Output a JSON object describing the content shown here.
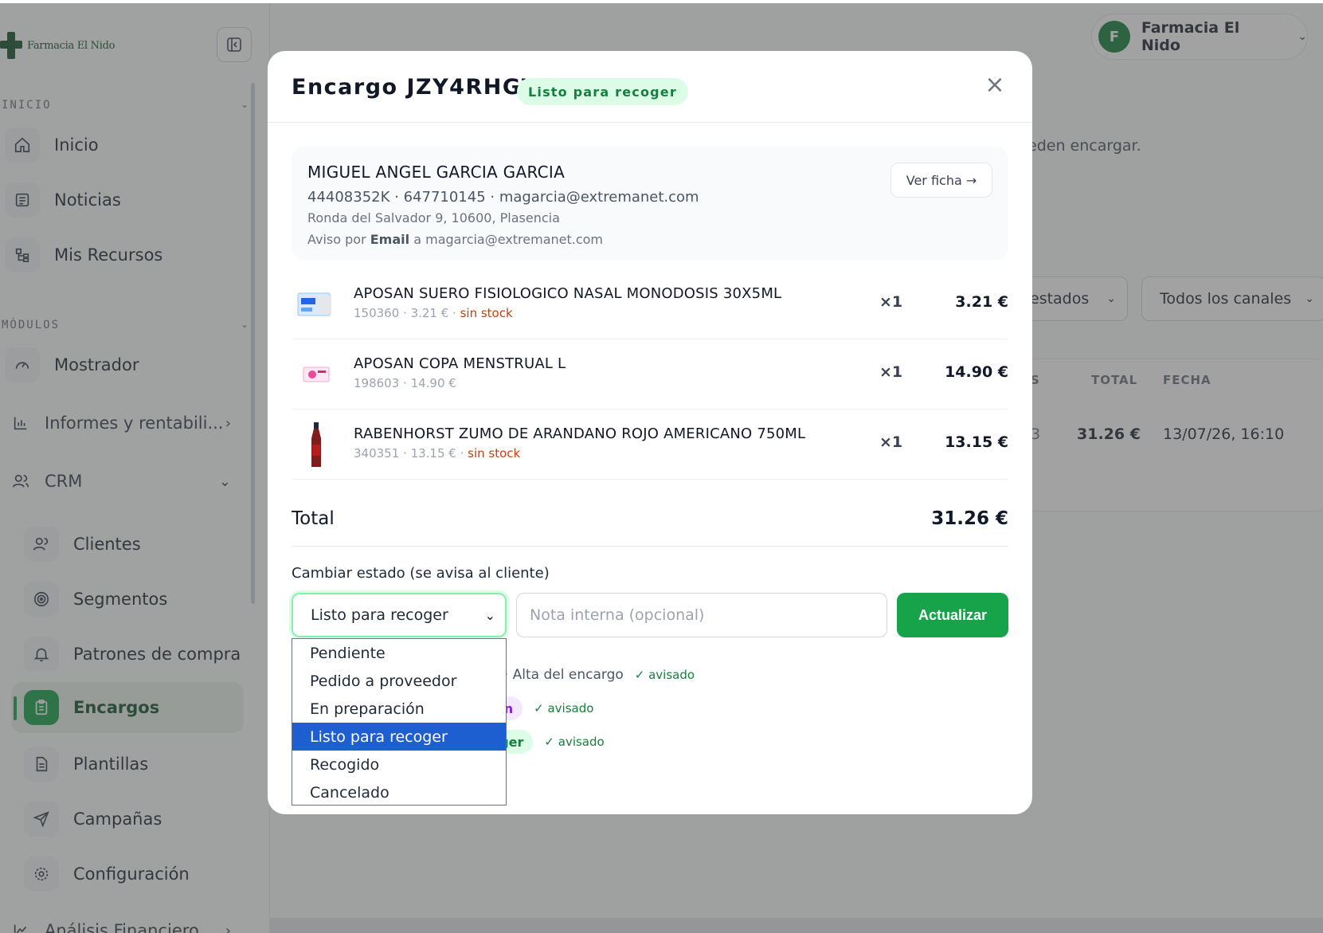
{
  "app": {
    "brand_name": "Farmacia El Nido",
    "user_initial": "F",
    "user_name": "Farmacia El Nido"
  },
  "sidebar": {
    "section_inicio": "INICIO",
    "section_modulos": "MÓDULOS",
    "items": [
      {
        "label": "Inicio",
        "icon": "home-icon"
      },
      {
        "label": "Noticias",
        "icon": "newspaper-icon"
      },
      {
        "label": "Mis Recursos",
        "icon": "resources-icon"
      },
      {
        "label": "Mostrador",
        "icon": "gauge-icon"
      },
      {
        "label": "Informes y rentabili...",
        "icon": "bar-chart-icon"
      },
      {
        "label": "CRM",
        "icon": "users-icon"
      },
      {
        "label": "Clientes",
        "icon": "users-icon"
      },
      {
        "label": "Segmentos",
        "icon": "target-icon"
      },
      {
        "label": "Patrones de compra",
        "icon": "bell-icon"
      },
      {
        "label": "Encargos",
        "icon": "clipboard-icon",
        "active": true
      },
      {
        "label": "Plantillas",
        "icon": "file-icon"
      },
      {
        "label": "Campañas",
        "icon": "send-icon"
      },
      {
        "label": "Configuración",
        "icon": "gear-icon"
      },
      {
        "label": "Análisis Financiero",
        "icon": "line-chart-icon"
      }
    ]
  },
  "background": {
    "partial_text": "eden encargar.",
    "filter_states": "estados",
    "filter_channels": "Todos los canales",
    "table_headers": [
      "S",
      "TOTAL",
      "FECHA"
    ],
    "row": {
      "partial": "3",
      "total": "31.26 €",
      "date": "13/07/26, 16:10"
    }
  },
  "modal": {
    "title": "Encargo JZY4RHGV",
    "status": "Listo para recoger",
    "close": "×",
    "customer": {
      "name": "MIGUEL ANGEL GARCIA GARCIA",
      "ids": "44408352K · 647710145 · magarcia@extremanet.com",
      "address": "Ronda del Salvador 9, 10600, Plasencia",
      "notice_prefix": "Aviso por",
      "notice_channel": "Email",
      "notice_suffix": "a magarcia@extremanet.com",
      "view_button": "Ver ficha →"
    },
    "items": [
      {
        "name": "APOSAN SUERO FISIOLOGICO NASAL MONODOSIS 30X5ML",
        "meta": "150360 · 3.21 €",
        "stock": "sin stock",
        "qty": "×1",
        "price": "3.21 €"
      },
      {
        "name": "APOSAN COPA MENSTRUAL L",
        "meta": "198603 · 14.90 €",
        "stock": "",
        "qty": "×1",
        "price": "14.90 €"
      },
      {
        "name": "RABENHORST ZUMO DE ARANDANO ROJO AMERICANO 750ML",
        "meta": "340351 · 13.15 €",
        "stock": "sin stock",
        "qty": "×1",
        "price": "13.15 €"
      }
    ],
    "total_label": "Total",
    "total_value": "31.26 €",
    "change_label": "Cambiar estado (se avisa al cliente)",
    "selected_state": "Listo para recoger",
    "note_placeholder": "Nota interna (opcional)",
    "update_button": "Actualizar",
    "history": [
      {
        "pill": "e",
        "pill_bg": "#fef3c7",
        "pill_color": "#b45309",
        "sep": "· Alta del encargo",
        "notified": "✓ avisado"
      },
      {
        "pill": "ación",
        "pill_bg": "#f3e8ff",
        "pill_color": "#7e22ce",
        "sep": "",
        "notified": "✓ avisado"
      },
      {
        "pill": "recoger",
        "pill_bg": "#dcfce7",
        "pill_color": "#15803d",
        "sep": "",
        "notified": "✓ avisado"
      }
    ]
  },
  "dropdown": {
    "options": [
      "Pendiente",
      "Pedido a proveedor",
      "En preparación",
      "Listo para recoger",
      "Recogido",
      "Cancelado"
    ],
    "selected_index": 3
  },
  "colors": {
    "brand_green": "#16a34a",
    "dropdown_selected": "#1d5fd1"
  }
}
